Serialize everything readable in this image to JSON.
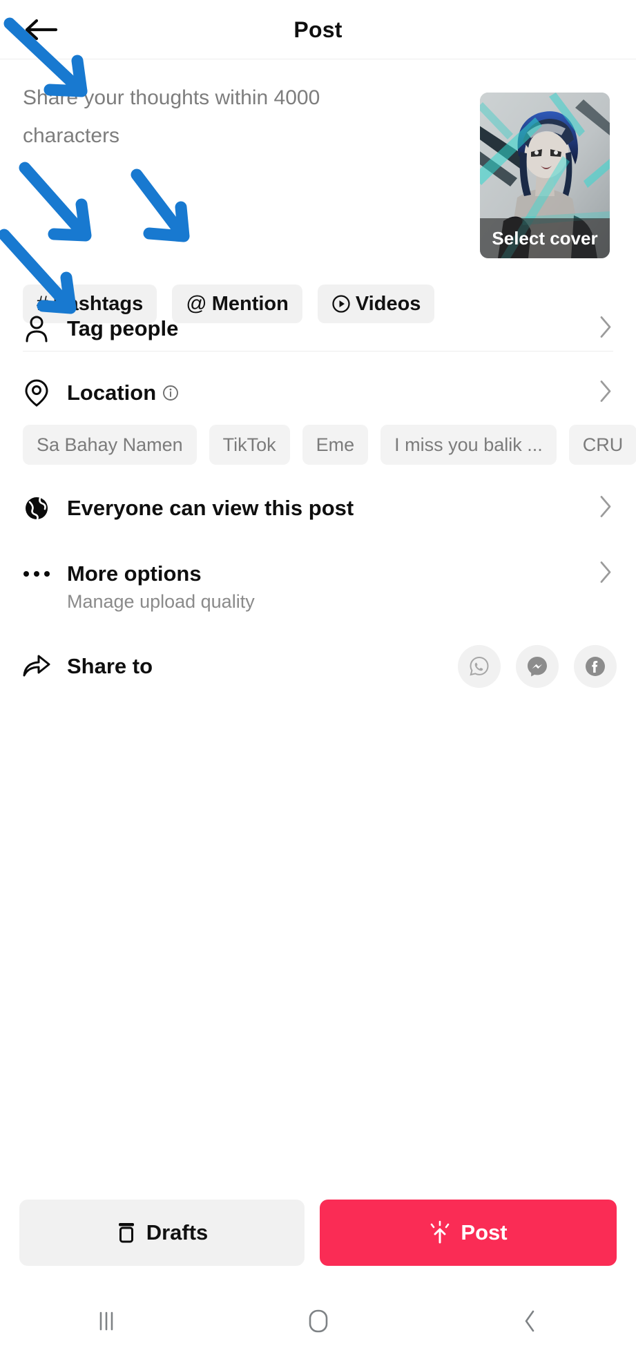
{
  "header": {
    "title": "Post",
    "back_icon": "arrow-left-icon"
  },
  "composer": {
    "placeholder": "Share your thoughts within 4000 characters",
    "value": "",
    "cover": {
      "label": "Select cover"
    }
  },
  "quick_chips": [
    {
      "icon": "hash-icon",
      "glyph": "#",
      "label": "Hashtags"
    },
    {
      "icon": "at-icon",
      "glyph": "@",
      "label": "Mention"
    },
    {
      "icon": "play-circle-icon",
      "glyph": "",
      "label": "Videos"
    }
  ],
  "rows": {
    "tag_people": {
      "icon": "person-icon",
      "label": "Tag people"
    },
    "location": {
      "icon": "location-pin-icon",
      "label": "Location",
      "info_icon": "info-circle-icon"
    },
    "privacy": {
      "icon": "globe-icon",
      "label": "Everyone can view this post"
    },
    "more": {
      "icon": "ellipsis-icon",
      "label": "More options",
      "sub": "Manage upload quality"
    },
    "share": {
      "icon": "share-arrow-icon",
      "label": "Share to"
    }
  },
  "location_suggestions": [
    "Sa Bahay Namen",
    "TikTok",
    "Eme",
    "I miss you balik ...",
    "CRU"
  ],
  "share_targets": [
    {
      "name": "whatsapp-icon",
      "label": "WhatsApp"
    },
    {
      "name": "messenger-icon",
      "label": "Messenger"
    },
    {
      "name": "facebook-icon",
      "label": "Facebook"
    }
  ],
  "bottom_bar": {
    "drafts_label": "Drafts",
    "drafts_icon": "drafts-box-icon",
    "post_label": "Post",
    "post_icon": "post-burst-icon"
  },
  "nav_bar": [
    {
      "name": "recents-icon"
    },
    {
      "name": "home-icon"
    },
    {
      "name": "back-icon"
    }
  ],
  "colors": {
    "accent_red": "#fa2c55",
    "annotation_blue": "#1879d0",
    "chip_bg": "#f1f1f1",
    "muted_text": "#7d7d7d",
    "divider": "#ededed"
  },
  "annotations": {
    "arrow_count": 4,
    "targets": [
      "composer-placeholder",
      "hashtags-chip",
      "mention-chip",
      "tag-people-row"
    ]
  }
}
